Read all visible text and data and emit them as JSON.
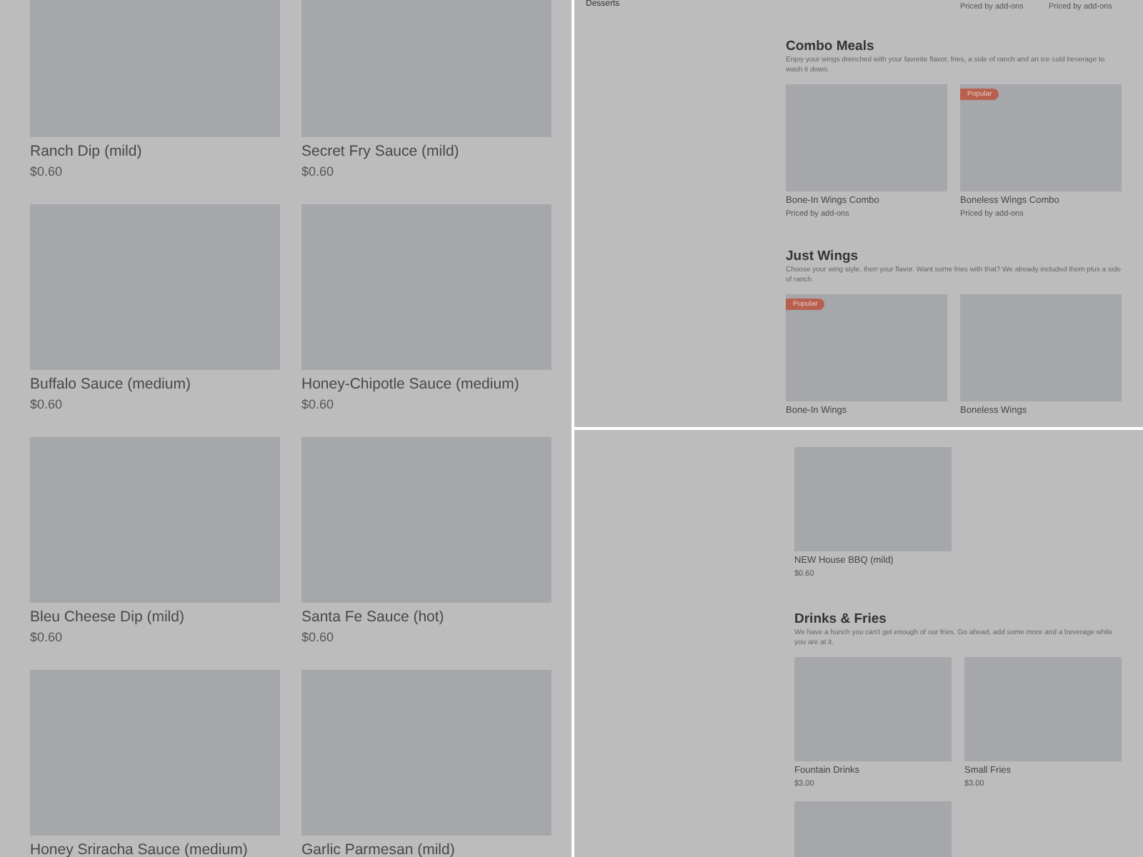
{
  "left_panel": {
    "items": [
      {
        "name": "Ranch Dip (mild)",
        "price": "$0.60"
      },
      {
        "name": "Secret Fry Sauce (mild)",
        "price": "$0.60"
      },
      {
        "name": "Buffalo Sauce (medium)",
        "price": "$0.60"
      },
      {
        "name": "Honey-Chipotle Sauce (medium)",
        "price": "$0.60"
      },
      {
        "name": "Bleu Cheese Dip (mild)",
        "price": "$0.60"
      },
      {
        "name": "Santa Fe Sauce (hot)",
        "price": "$0.60"
      },
      {
        "name": "Honey Sriracha Sauce (medium)"
      },
      {
        "name": "Garlic Parmesan (mild)"
      }
    ]
  },
  "top_right_panel": {
    "sidebar_items": [
      "Desserts"
    ],
    "top_prices": [
      "Priced by add-ons",
      "Priced by add-ons"
    ],
    "sections": [
      {
        "title": "Combo Meals",
        "description": "Enjoy your wings drenched with your favorite flavor, fries, a side of ranch and an ice cold beverage to wash it down.",
        "items": [
          {
            "name": "Bone-In Wings Combo",
            "price": "Priced by add-ons"
          },
          {
            "name": "Boneless Wings Combo",
            "price": "Priced by add-ons",
            "badge": "Popular"
          }
        ]
      },
      {
        "title": "Just Wings",
        "description": "Choose your wing style, then your flavor. Want some fries with that? We already included them plus a side of ranch.",
        "items": [
          {
            "name": "Bone-In Wings",
            "badge": "Popular"
          },
          {
            "name": "Boneless Wings"
          }
        ]
      }
    ]
  },
  "bottom_right_panel": {
    "items": [
      {
        "name": "NEW House BBQ (mild)",
        "price": "$0.60"
      }
    ],
    "sections": [
      {
        "title": "Drinks & Fries",
        "description": "We have a hunch you can't get enough of our fries. Go ahead, add some more and a beverage while you are at it.",
        "items": [
          {
            "kind": "card",
            "name": "Fountain Drinks",
            "price": "$3.00"
          },
          {
            "kind": "card",
            "name": "Small Fries",
            "price": "$3.00"
          },
          {
            "kind": "image_only"
          }
        ]
      }
    ]
  }
}
